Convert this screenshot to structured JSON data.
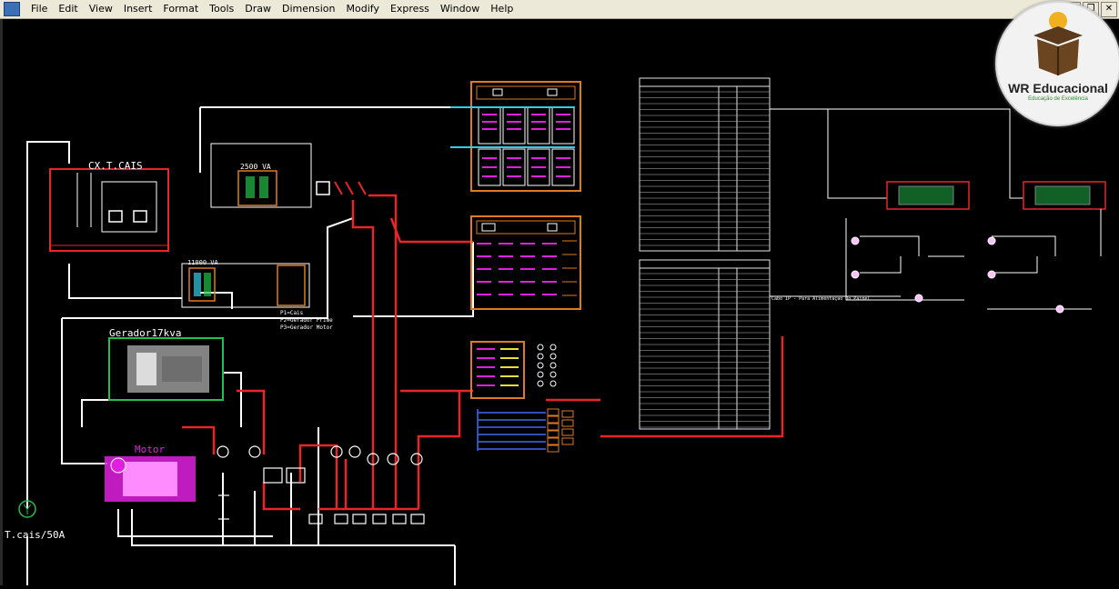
{
  "menu": {
    "items": [
      "File",
      "Edit",
      "View",
      "Insert",
      "Format",
      "Tools",
      "Draw",
      "Dimension",
      "Modify",
      "Express",
      "Window",
      "Help"
    ]
  },
  "window_buttons": {
    "minimize": "_",
    "restore": "❐",
    "close": "✕"
  },
  "logo": {
    "name": "WR Educacional",
    "tagline": "Educação de Excelência"
  },
  "drawing": {
    "cx_t_cais": "CX.T.CAIS",
    "gerador": "Gerador17kva",
    "motor": "Motor",
    "tcais": "T.cais/50A",
    "transformer_1": "2500 VA",
    "transformer_2": "11000 VA",
    "legend_p1": "P1=Cais",
    "legend_p2": "P2=Gerador Prime",
    "legend_p3": "P3=Gerador Motor",
    "cable_note": "Cabo IP - Para Alimentação Do Painel"
  },
  "colors": {
    "wire_white": "#ffffff",
    "wire_red": "#e8262a",
    "panel_orange": "#e07a1f",
    "cyan": "#2fd0e6",
    "magenta": "#e020e0",
    "green": "#22c04a",
    "yellow": "#e8e030",
    "table_border": "#e6e6e6"
  }
}
